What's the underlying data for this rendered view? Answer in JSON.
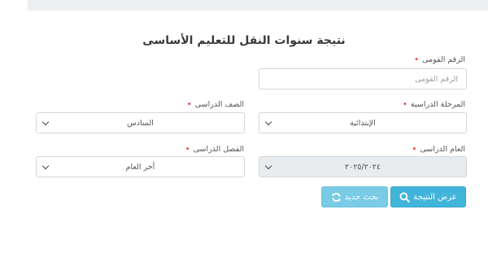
{
  "page": {
    "title": "نتيجة سنوات النقل للتعليم الأساسى"
  },
  "form": {
    "national_id": {
      "label": "الرقم القومى",
      "placeholder": "الرقم القومى",
      "required_mark": "•"
    },
    "stage": {
      "label": "المرحلة الدراسية",
      "value": "الإبتدائية",
      "required_mark": "•"
    },
    "grade": {
      "label": "الصف الدراسى",
      "value": "السادس",
      "required_mark": "•"
    },
    "year": {
      "label": "العام الدراسى",
      "value": "٢٠٢٥/٢٠٢٤",
      "required_mark": "•"
    },
    "term": {
      "label": "الفصل الدراسى",
      "value": "أخر العام",
      "required_mark": "•"
    }
  },
  "buttons": {
    "show_result": {
      "label": "عرض النتيجة",
      "icon": "search-icon"
    },
    "new_search": {
      "label": "بحث جديد",
      "icon": "refresh-icon"
    }
  },
  "colors": {
    "primary": "#41b4da",
    "secondary": "#79cbe6",
    "required": "#e53935",
    "band": "#eceef2"
  }
}
